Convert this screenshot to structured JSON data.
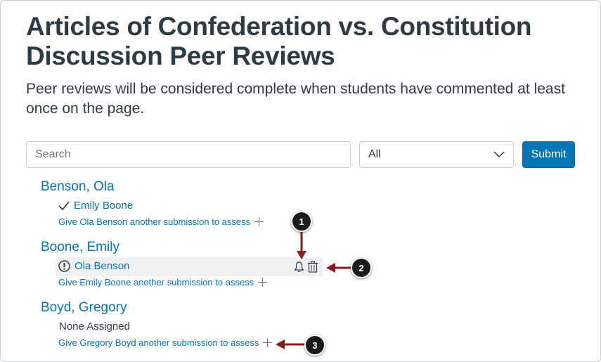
{
  "header": {
    "title": "Articles of Confederation vs. Constitution Discussion Peer Reviews",
    "description": "Peer reviews will be considered complete when students have commented at least once on the page."
  },
  "toolbar": {
    "search_placeholder": "Search",
    "filter_value": "All",
    "submit_label": "Submit"
  },
  "students": [
    {
      "name": "Benson, Ola",
      "reviewer": "Emily Boone",
      "reviewer_status": "completed",
      "status_icon": "checkmark-icon",
      "give_link": "Give Ola Benson another submission to assess"
    },
    {
      "name": "Boone, Emily",
      "reviewer": "Ola Benson",
      "reviewer_status": "incomplete",
      "status_icon": "warning-icon",
      "give_link": "Give Emily Boone another submission to assess"
    },
    {
      "name": "Boyd, Gregory",
      "none_label": "None Assigned",
      "give_link": "Give Gregory Boyd another submission to assess"
    }
  ],
  "callouts": [
    "1",
    "2",
    "3"
  ],
  "colors": {
    "link": "#0374b5",
    "text": "#2d3b45",
    "button": "#0374b5",
    "row_highlight": "#f0f1f2",
    "callout_arrow": "#8b1a1a"
  }
}
